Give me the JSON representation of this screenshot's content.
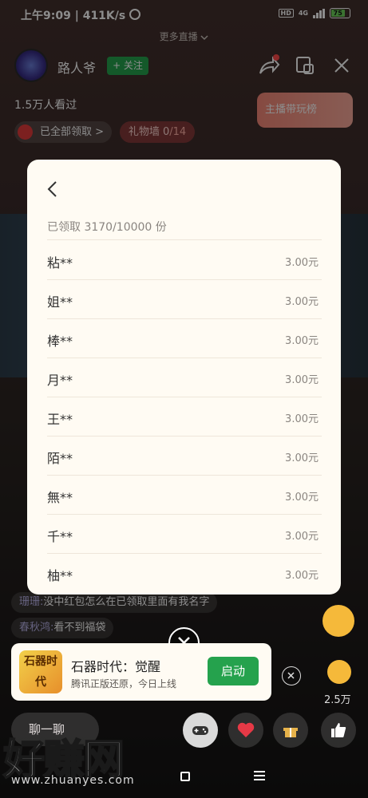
{
  "status_bar": {
    "time": "上午9:09",
    "network_speed": "411K/s",
    "hd": "HD",
    "network_type": "4G",
    "battery": "75"
  },
  "top": {
    "more_live": "更多直播",
    "streamer_name": "路人爷",
    "follow_label": "+ 关注",
    "viewers": "1.5万人看过",
    "rank_label": "主播带玩榜",
    "claimed_label": "已全部领取 >",
    "gift_wall_label": "礼物墙 0",
    "gift_wall_total": "/14"
  },
  "chat": [
    {
      "user": "珊珊:",
      "message": "没中红包怎么在已领取里面有我名字"
    },
    {
      "user": "春秋鸿:",
      "message": "看不到福袋"
    }
  ],
  "modal": {
    "summary": "已领取 3170/10000 份",
    "records": [
      {
        "name": "粘**",
        "amount": "3.00元"
      },
      {
        "name": "姐**",
        "amount": "3.00元"
      },
      {
        "name": "棒**",
        "amount": "3.00元"
      },
      {
        "name": "月**",
        "amount": "3.00元"
      },
      {
        "name": "王**",
        "amount": "3.00元"
      },
      {
        "name": "陌**",
        "amount": "3.00元"
      },
      {
        "name": "無**",
        "amount": "3.00元"
      },
      {
        "name": "千**",
        "amount": "3.00元"
      },
      {
        "name": "柚**",
        "amount": "3.00元"
      }
    ]
  },
  "promo": {
    "logo_text": "石器时代",
    "title": "石器时代：觉醒",
    "subtitle": "腾讯正版还原，今日上线",
    "button": "启动"
  },
  "right_rail": {
    "like_count": "2.5万"
  },
  "bottom_bar": {
    "chat_placeholder": "聊一聊"
  },
  "watermark": {
    "text": "好赚网",
    "url": "www.zhuanyes.com"
  },
  "colors": {
    "accent_green": "#25a24d",
    "modal_bg": "#fffbf3",
    "rank_pink": "#f58777",
    "notification_red": "#ff4a4a"
  },
  "icons": [
    "alarm-icon",
    "signal-icon",
    "battery-icon",
    "chevron-down-icon",
    "share-icon",
    "window-icon",
    "close-icon",
    "back-chevron-icon",
    "red-envelope-icon",
    "game-controller-icon",
    "heart-icon",
    "gift-icon",
    "thumbs-up-icon"
  ]
}
